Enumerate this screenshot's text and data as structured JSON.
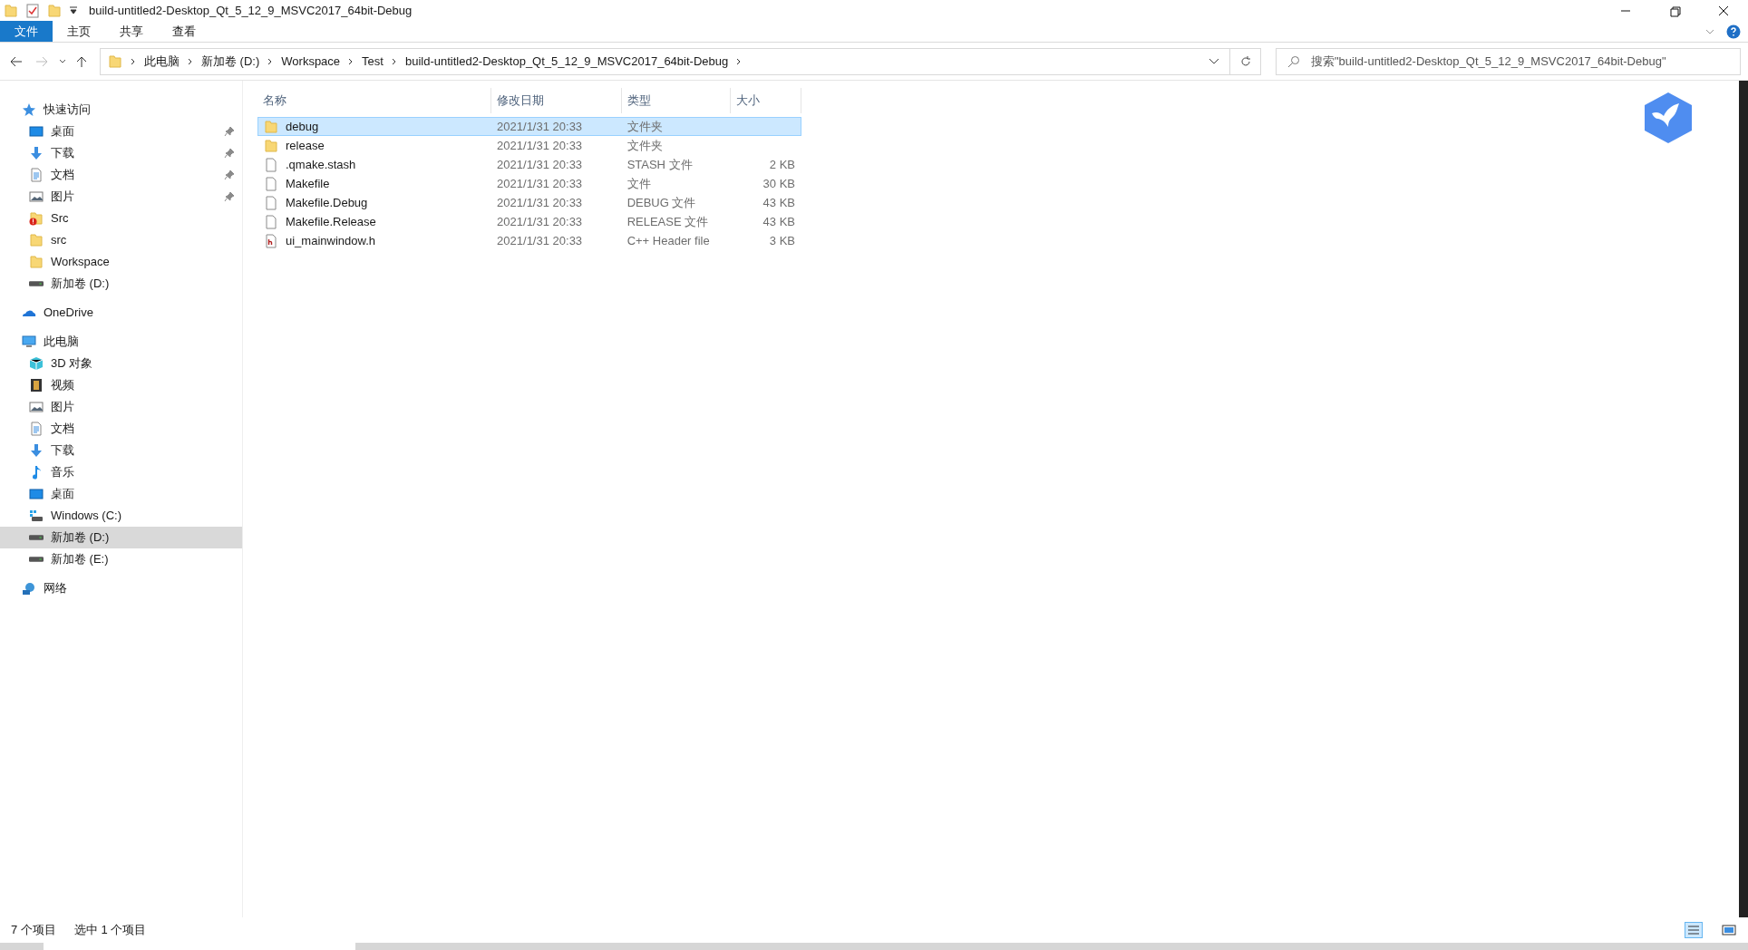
{
  "window": {
    "title": "build-untitled2-Desktop_Qt_5_12_9_MSVC2017_64bit-Debug"
  },
  "ribbon_tabs": [
    {
      "label": "文件",
      "selected": true
    },
    {
      "label": "主页",
      "selected": false
    },
    {
      "label": "共享",
      "selected": false
    },
    {
      "label": "查看",
      "selected": false
    }
  ],
  "breadcrumb": [
    "此电脑",
    "新加卷 (D:)",
    "Workspace",
    "Test",
    "build-untitled2-Desktop_Qt_5_12_9_MSVC2017_64bit-Debug"
  ],
  "search": {
    "placeholder": "搜索\"build-untitled2-Desktop_Qt_5_12_9_MSVC2017_64bit-Debug\""
  },
  "sidebar": [
    {
      "label": "快速访问",
      "kind": "star",
      "selected": false,
      "children": [
        {
          "label": "桌面",
          "kind": "desktop",
          "pinned": true,
          "selected": false
        },
        {
          "label": "下载",
          "kind": "download",
          "pinned": true,
          "selected": false
        },
        {
          "label": "文档",
          "kind": "document",
          "pinned": true,
          "selected": false
        },
        {
          "label": "图片",
          "kind": "image",
          "pinned": true,
          "selected": false
        },
        {
          "label": "Src",
          "kind": "folder-alert",
          "pinned": false,
          "selected": false
        },
        {
          "label": "src",
          "kind": "folder",
          "pinned": false,
          "selected": false
        },
        {
          "label": "Workspace",
          "kind": "folder",
          "pinned": false,
          "selected": false
        },
        {
          "label": "新加卷 (D:)",
          "kind": "drive",
          "pinned": false,
          "selected": false
        }
      ]
    },
    {
      "label": "OneDrive",
      "kind": "cloud",
      "selected": false
    },
    {
      "label": "此电脑",
      "kind": "pc",
      "selected": false,
      "children": [
        {
          "label": "3D 对象",
          "kind": "cube",
          "pinned": false,
          "selected": false
        },
        {
          "label": "视频",
          "kind": "video",
          "pinned": false,
          "selected": false
        },
        {
          "label": "图片",
          "kind": "image",
          "pinned": false,
          "selected": false
        },
        {
          "label": "文档",
          "kind": "document",
          "pinned": false,
          "selected": false
        },
        {
          "label": "下载",
          "kind": "download",
          "pinned": false,
          "selected": false
        },
        {
          "label": "音乐",
          "kind": "music",
          "pinned": false,
          "selected": false
        },
        {
          "label": "桌面",
          "kind": "desktop",
          "pinned": false,
          "selected": false
        },
        {
          "label": "Windows (C:)",
          "kind": "windows-drive",
          "pinned": false,
          "selected": false
        },
        {
          "label": "新加卷 (D:)",
          "kind": "drive",
          "pinned": false,
          "selected": true
        },
        {
          "label": "新加卷 (E:)",
          "kind": "drive",
          "pinned": false,
          "selected": false
        }
      ]
    },
    {
      "label": "网络",
      "kind": "network",
      "selected": false
    }
  ],
  "table": {
    "columns": [
      "名称",
      "修改日期",
      "类型",
      "大小"
    ],
    "rows": [
      {
        "name": "debug",
        "kind": "folder",
        "date": "2021/1/31 20:33",
        "type": "文件夹",
        "selected": true
      },
      {
        "name": "release",
        "kind": "folder",
        "date": "2021/1/31 20:33",
        "type": "文件夹",
        "selected": false
      },
      {
        "name": ".qmake.stash",
        "kind": "file",
        "date": "2021/1/31 20:33",
        "type": "STASH 文件",
        "size": "2 KB",
        "selected": false
      },
      {
        "name": "Makefile",
        "kind": "file",
        "date": "2021/1/31 20:33",
        "type": "文件",
        "size": "30 KB",
        "selected": false
      },
      {
        "name": "Makefile.Debug",
        "kind": "file",
        "date": "2021/1/31 20:33",
        "type": "DEBUG 文件",
        "size": "43 KB",
        "selected": false
      },
      {
        "name": "Makefile.Release",
        "kind": "file",
        "date": "2021/1/31 20:33",
        "type": "RELEASE 文件",
        "size": "43 KB",
        "selected": false
      },
      {
        "name": "ui_mainwindow.h",
        "kind": "header",
        "date": "2021/1/31 20:33",
        "type": "C++ Header file",
        "size": "3 KB",
        "selected": false
      }
    ]
  },
  "status_bar": {
    "count": "7 个项目",
    "selection": "选中 1 个项目"
  }
}
